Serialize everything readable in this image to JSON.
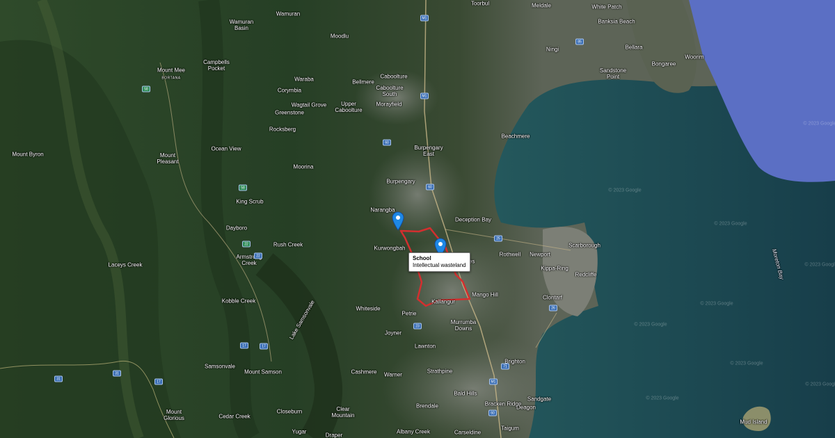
{
  "map": {
    "popup": {
      "title": "School",
      "description": "Intellectual wasteland"
    },
    "watermark": "© 2023 Google",
    "places": [
      {
        "id": "toorbul",
        "label": "Toorbul"
      },
      {
        "id": "meldale",
        "label": "Meldale"
      },
      {
        "id": "white-patch",
        "label": "White Patch"
      },
      {
        "id": "banksia-beach",
        "label": "Banksia Beach"
      },
      {
        "id": "bellara",
        "label": "Bellara"
      },
      {
        "id": "woorim",
        "label": "Woorim"
      },
      {
        "id": "bongaree",
        "label": "Bongaree"
      },
      {
        "id": "sandstone-point",
        "label": "Sandstone\nPoint"
      },
      {
        "id": "ningi",
        "label": "Ningi"
      },
      {
        "id": "wamuran",
        "label": "Wamuran"
      },
      {
        "id": "wamuran-basin",
        "label": "Wamuran\nBasin"
      },
      {
        "id": "moodlu",
        "label": "Moodlu"
      },
      {
        "id": "caboolture",
        "label": "Caboolture"
      },
      {
        "id": "bellmere",
        "label": "Bellmere"
      },
      {
        "id": "caboolture-south",
        "label": "Caboolture\nSouth"
      },
      {
        "id": "morayfield",
        "label": "Morayfield"
      },
      {
        "id": "upper-caboolture",
        "label": "Upper\nCaboolture"
      },
      {
        "id": "mount-mee",
        "label": "Mount Mee"
      },
      {
        "id": "bortana",
        "label": "BORTANA"
      },
      {
        "id": "campbells-pocket",
        "label": "Campbells\nPocket"
      },
      {
        "id": "waraba",
        "label": "Waraba"
      },
      {
        "id": "corymbia",
        "label": "Corymbia"
      },
      {
        "id": "wagtail-grove",
        "label": "Wagtail Grove"
      },
      {
        "id": "greenstone",
        "label": "Greenstone"
      },
      {
        "id": "rocksberg",
        "label": "Rocksberg"
      },
      {
        "id": "beachmere",
        "label": "Beachmere"
      },
      {
        "id": "burpengary-east",
        "label": "Burpengary\nEast"
      },
      {
        "id": "mount-byron",
        "label": "Mount Byron"
      },
      {
        "id": "mount-pleasant",
        "label": "Mount\nPleasant"
      },
      {
        "id": "ocean-view",
        "label": "Ocean View"
      },
      {
        "id": "moorina",
        "label": "Moorina"
      },
      {
        "id": "burpengary",
        "label": "Burpengary"
      },
      {
        "id": "king-scrub",
        "label": "King Scrub"
      },
      {
        "id": "narangba",
        "label": "Narangba"
      },
      {
        "id": "deception-bay",
        "label": "Deception Bay"
      },
      {
        "id": "dayboro",
        "label": "Dayboro"
      },
      {
        "id": "rush-creek",
        "label": "Rush Creek"
      },
      {
        "id": "kurwongbah",
        "label": "Kurwongbah"
      },
      {
        "id": "scarborough",
        "label": "Scarborough"
      },
      {
        "id": "newport",
        "label": "Newport"
      },
      {
        "id": "rothwell",
        "label": "Rothwell"
      },
      {
        "id": "kippa-ring",
        "label": "Kippa-Ring"
      },
      {
        "id": "redcliffe",
        "label": "Redcliffe"
      },
      {
        "id": "armstrong-creek",
        "label": "Armstrong\nCreek"
      },
      {
        "id": "laceys-creek",
        "label": "Laceys Creek"
      },
      {
        "id": "mango-hill",
        "label": "Mango Hill"
      },
      {
        "id": "clontarf",
        "label": "Clontarf"
      },
      {
        "id": "kallangur",
        "label": "Kallangur"
      },
      {
        "id": "kobble-creek",
        "label": "Kobble Creek"
      },
      {
        "id": "whiteside",
        "label": "Whiteside"
      },
      {
        "id": "petrie",
        "label": "Petrie"
      },
      {
        "id": "murrumba-downs",
        "label": "Murrumba\nDowns"
      },
      {
        "id": "lake-samsonvale",
        "label": "Lake Samsonvale"
      },
      {
        "id": "joyner",
        "label": "Joyner"
      },
      {
        "id": "lawnton",
        "label": "Lawnton"
      },
      {
        "id": "brighton",
        "label": "Brighton"
      },
      {
        "id": "samsonvale",
        "label": "Samsonvale"
      },
      {
        "id": "mount-samson",
        "label": "Mount Samson"
      },
      {
        "id": "cashmere",
        "label": "Cashmere"
      },
      {
        "id": "warner",
        "label": "Warner"
      },
      {
        "id": "strathpine",
        "label": "Strathpine"
      },
      {
        "id": "bald-hills",
        "label": "Bald Hills"
      },
      {
        "id": "bracken-ridge",
        "label": "Bracken Ridge"
      },
      {
        "id": "sandgate",
        "label": "Sandgate"
      },
      {
        "id": "brendale",
        "label": "Brendale"
      },
      {
        "id": "deagon",
        "label": "Deagon"
      },
      {
        "id": "mount-glorious",
        "label": "Mount\nGlorious"
      },
      {
        "id": "cedar-creek",
        "label": "Cedar Creek"
      },
      {
        "id": "closeburn",
        "label": "Closeburn"
      },
      {
        "id": "clear-mountain",
        "label": "Clear\nMountain"
      },
      {
        "id": "yugar",
        "label": "Yugar"
      },
      {
        "id": "draper",
        "label": "Draper"
      },
      {
        "id": "albany-creek",
        "label": "Albany Creek"
      },
      {
        "id": "carseldine",
        "label": "Carseldine"
      },
      {
        "id": "taigum",
        "label": "Taigum"
      },
      {
        "id": "mud-island",
        "label": "Mud Island"
      },
      {
        "id": "moreton-bay",
        "label": "Moreton Bay"
      },
      {
        "id": "north-lakes-part",
        "label": "akes"
      }
    ],
    "road_shields": [
      "M1",
      "M1",
      "60",
      "85",
      "58",
      "58",
      "22",
      "22",
      "17",
      "17",
      "25",
      "26",
      "23",
      "71",
      "31",
      "31",
      "M1",
      "60",
      "60",
      "17"
    ]
  },
  "colors": {
    "route": "#d32f2f",
    "pin": "#1e88e5",
    "sea": "#1f4f57",
    "deep_sea": "#5b6fc4"
  }
}
